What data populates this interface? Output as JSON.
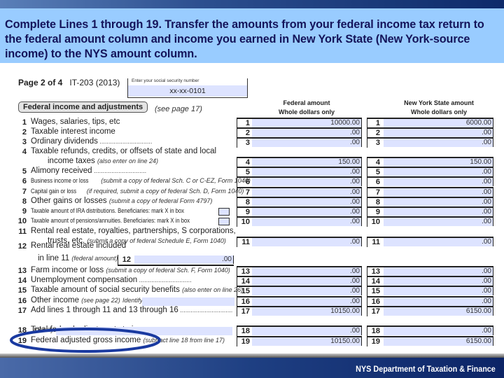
{
  "banner": {
    "text": "Complete Lines 1 through 19.  Transfer the amounts from your federal income tax return to the federal amount column and income you earned in New York State (New York-source income) to the NYS amount column."
  },
  "form": {
    "page_label": "Page 2 of 4",
    "form_id": "IT-203 (2013)",
    "ssn_label": "Enter your social security number",
    "ssn_value": "xx-xx-0101",
    "section_title": "Federal income and adjustments",
    "section_note": "(see page 17)",
    "federal_header": "Federal amount",
    "nys_header": "New York State amount",
    "whole_dollars": "Whole dollars only",
    "line12_amount": ".00",
    "rows": [
      {
        "n": "1",
        "label": "Wages, salaries, tips, etc",
        "fed": "10000.00",
        "nys": "6000.00"
      },
      {
        "n": "2",
        "label": "Taxable interest income",
        "fed": ".00",
        "nys": ".00"
      },
      {
        "n": "3",
        "label": "Ordinary dividends",
        "fed": ".00",
        "nys": ".00"
      },
      {
        "n": "4",
        "label": "Taxable refunds, credits, or offsets of state and local",
        "label2": "income taxes",
        "note": "(also enter on line 24)",
        "fed": "150.00",
        "nys": "150.00"
      },
      {
        "n": "5",
        "label": "Alimony received",
        "fed": ".00",
        "nys": ".00"
      },
      {
        "n": "6",
        "label": "Business income or loss",
        "note": "(submit a copy of federal Sch. C or C-EZ, Form 1040)",
        "fed": ".00",
        "nys": ".00"
      },
      {
        "n": "7",
        "label": "Capital gain or loss",
        "note": "(if required, submit a copy of federal Sch. D, Form 1040)",
        "fed": ".00",
        "nys": ".00"
      },
      {
        "n": "8",
        "label": "Other gains or losses",
        "note": "(submit a copy of federal Form 4797)",
        "fed": ".00",
        "nys": ".00"
      },
      {
        "n": "9",
        "label": "Taxable amount of IRA distributions. Beneficiaries: mark X in box",
        "fed": ".00",
        "nys": ".00"
      },
      {
        "n": "10",
        "label": "Taxable amount of pensions/annuities. Beneficiaries: mark X in box",
        "fed": ".00",
        "nys": ".00"
      },
      {
        "n": "11",
        "label": "Rental real estate, royalties, partnerships, S corporations,",
        "label2": "trusts, etc.",
        "note": "(submit a copy of federal Schedule E, Form 1040)",
        "fed": ".00",
        "nys": ".00"
      },
      {
        "n": "12",
        "label": "Rental real estate included",
        "label2": "in line 11",
        "note": "(federal amount)"
      },
      {
        "n": "13",
        "label": "Farm income or loss",
        "note": "(submit a copy of federal Sch. F, Form 1040)",
        "fed": ".00",
        "nys": ".00"
      },
      {
        "n": "14",
        "label": "Unemployment compensation",
        "fed": ".00",
        "nys": ".00"
      },
      {
        "n": "15",
        "label": "Taxable amount of social security benefits",
        "note": "(also enter on line 26)",
        "fed": ".00",
        "nys": ".00"
      },
      {
        "n": "16",
        "label": "Other income",
        "note": "(see page 22)",
        "identify": "Identify:",
        "fed": ".00",
        "nys": ".00"
      },
      {
        "n": "17",
        "label": "Add lines 1 through 11 and 13 through 16",
        "fed": "10150.00",
        "nys": "6150.00"
      },
      {
        "n": "18",
        "label": "Total federal adjustments to income",
        "note": "(see page 22)",
        "identify": "Identify:",
        "fed": ".00",
        "nys": ".00"
      },
      {
        "n": "19",
        "label": "Federal adjusted gross income",
        "note": "(subtract line 18 from line 17)",
        "fed": "10150.00",
        "nys": "6150.00"
      }
    ]
  },
  "annotation": {
    "ellipse_color": "#1a3aa0",
    "highlighted_line": "19"
  },
  "footer": {
    "text": "NYS Department of Taxation & Finance"
  }
}
